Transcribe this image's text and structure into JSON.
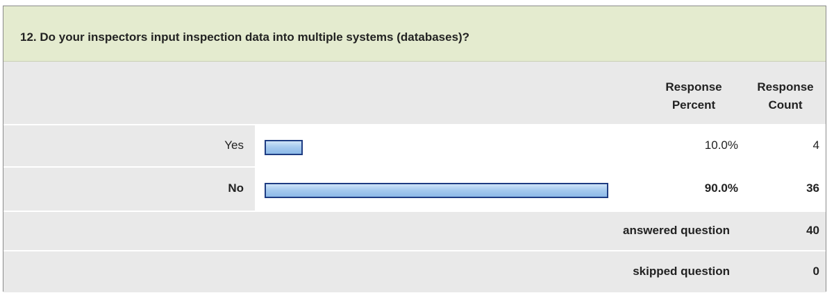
{
  "question": {
    "title": "12. Do your inspectors input inspection data into multiple systems (databases)?"
  },
  "headers": {
    "percent_line1": "Response",
    "percent_line2": "Percent",
    "count_line1": "Response",
    "count_line2": "Count"
  },
  "chart_data": {
    "type": "bar",
    "categories": [
      "Yes",
      "No"
    ],
    "series": [
      {
        "values": [
          10.0,
          90.0
        ]
      }
    ],
    "percent_labels": [
      "10.0%",
      "90.0%"
    ],
    "counts": [
      "4",
      "36"
    ],
    "xlim": [
      0,
      100
    ],
    "orientation": "horizontal"
  },
  "rows": [
    {
      "label": "Yes",
      "percent": "10.0%",
      "count": "4"
    },
    {
      "label": "No",
      "percent": "90.0%",
      "count": "36"
    }
  ],
  "summary": {
    "answered_label": "answered question",
    "answered_value": "40",
    "skipped_label": "skipped question",
    "skipped_value": "0"
  },
  "colors": {
    "title_bg": "#e4ebcf",
    "bar_border": "#1e3c82",
    "bar_fill": "#a7cbef"
  }
}
